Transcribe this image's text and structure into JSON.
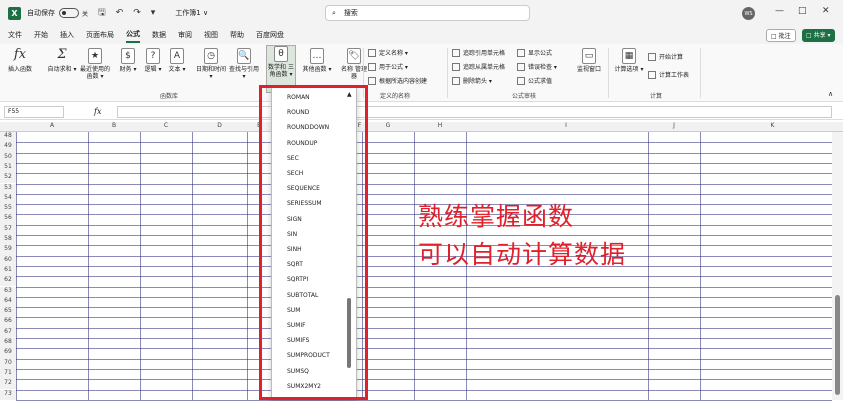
{
  "titlebar": {
    "app_logo": "X",
    "autosave": "自动保存",
    "toggle_label": "关",
    "save_icon": "save-icon",
    "doc_title": "工作簿1 ∨",
    "search_placeholder": "搜索",
    "avatar": "WS",
    "min": "—",
    "max": "□",
    "close": "✕"
  },
  "tabs": [
    "文件",
    "开始",
    "插入",
    "页面布局",
    "公式",
    "数据",
    "审阅",
    "视图",
    "帮助",
    "百度网盘"
  ],
  "active_tab": "公式",
  "comment_btn": "□ 批注",
  "share_btn": "□ 共享 ▾",
  "ribbon": {
    "buttons": [
      {
        "label": "插入函数",
        "icon": "fx"
      },
      {
        "label": "自动求和 ▾",
        "icon": "Σ"
      },
      {
        "label": "最近使用的 函数 ▾",
        "icon": "★"
      },
      {
        "label": "财务 ▾",
        "icon": "$"
      },
      {
        "label": "逻辑 ▾",
        "icon": "?"
      },
      {
        "label": "文本 ▾",
        "icon": "A"
      },
      {
        "label": "日期和时间 ▾",
        "icon": "◷"
      },
      {
        "label": "查找与引用 ▾",
        "icon": "🔍"
      },
      {
        "label": "数学和 三角函数 ▾",
        "icon": "θ"
      },
      {
        "label": "其他函数 ▾",
        "icon": "…"
      },
      {
        "label": "名称 管理器",
        "icon": "🏷"
      }
    ],
    "def_name": [
      "定义名称 ▾",
      "用于公式 ▾",
      "根据所选内容创建"
    ],
    "audit": [
      "追踪引用单元格",
      "追踪从属单元格",
      "删除箭头 ▾",
      "显示公式",
      "错误检查 ▾",
      "公式求值"
    ],
    "watch": "监视窗口",
    "calc": [
      "计算选项 ▾",
      "开始计算",
      "计算工作表"
    ],
    "group_labels": [
      "函数库",
      "定义的名称",
      "公式审核",
      "计算"
    ]
  },
  "formula_bar": {
    "name_box": "F55",
    "fx": "fx"
  },
  "columns": [
    "A",
    "B",
    "C",
    "D",
    "E",
    "F",
    "G",
    "H",
    "I",
    "J",
    "K"
  ],
  "rows": [
    "48",
    "49",
    "50",
    "51",
    "52",
    "53",
    "54",
    "55",
    "56",
    "57",
    "58",
    "59",
    "60",
    "61",
    "62",
    "63",
    "64",
    "65",
    "66",
    "67",
    "68",
    "69",
    "70",
    "71",
    "72",
    "73"
  ],
  "dropdown_items": [
    "ROMAN",
    "ROUND",
    "ROUNDDOWN",
    "ROUNDUP",
    "SEC",
    "SECH",
    "SEQUENCE",
    "SERIESSUM",
    "SIGN",
    "SIN",
    "SINH",
    "SQRT",
    "SQRTPI",
    "SUBTOTAL",
    "SUM",
    "SUMIF",
    "SUMIFS",
    "SUMPRODUCT",
    "SUMSQ",
    "SUMX2MY2"
  ],
  "annotation": [
    "熟练掌握函数",
    "可以自动计算数据"
  ],
  "colors": {
    "accent": "#1d7044",
    "annotation": "#e0202a"
  }
}
